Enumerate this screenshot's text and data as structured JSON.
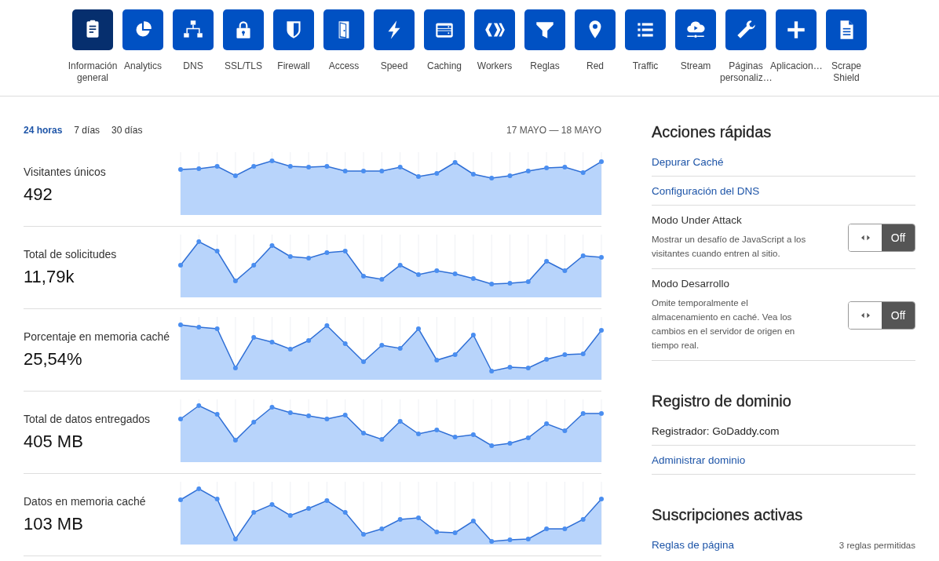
{
  "nav": [
    {
      "label": "Información general",
      "selected": true
    },
    {
      "label": "Analytics",
      "selected": false
    },
    {
      "label": "DNS",
      "selected": false
    },
    {
      "label": "SSL/TLS",
      "selected": false
    },
    {
      "label": "Firewall",
      "selected": false
    },
    {
      "label": "Access",
      "selected": false
    },
    {
      "label": "Speed",
      "selected": false
    },
    {
      "label": "Caching",
      "selected": false
    },
    {
      "label": "Workers",
      "selected": false
    },
    {
      "label": "Reglas",
      "selected": false
    },
    {
      "label": "Red",
      "selected": false
    },
    {
      "label": "Traffic",
      "selected": false
    },
    {
      "label": "Stream",
      "selected": false
    },
    {
      "label": "Páginas personaliz…",
      "selected": false
    },
    {
      "label": "Aplicacion…",
      "selected": false
    },
    {
      "label": "Scrape Shield",
      "selected": false
    }
  ],
  "range_tabs": [
    {
      "label": "24 horas",
      "selected": true
    },
    {
      "label": "7 días",
      "selected": false
    },
    {
      "label": "30 días",
      "selected": false
    }
  ],
  "date_range": "17 MAYO — 18 MAYO",
  "metrics": [
    {
      "label": "Visitantes únicos",
      "value": "492"
    },
    {
      "label": "Total de solicitudes",
      "value": "11,79k"
    },
    {
      "label": "Porcentaje en memoria caché",
      "value": "25,54%"
    },
    {
      "label": "Total de datos entregados",
      "value": "405 MB"
    },
    {
      "label": "Datos en memoria caché",
      "value": "103 MB"
    }
  ],
  "sidebar_sections": [
    {
      "title": "Acciones rápidas",
      "items": [
        {
          "kind": "link",
          "label": "Depurar Caché"
        },
        {
          "kind": "link",
          "label": "Configuración del DNS"
        },
        {
          "kind": "toggle",
          "label": "Modo Under Attack",
          "description": "Mostrar un desafío de JavaScript a los visitantes cuando entren al sitio.",
          "on": false,
          "state_label": "Off"
        },
        {
          "kind": "toggle",
          "label": "Modo Desarrollo",
          "description": "Omite temporalmente el almacenamiento en caché. Vea los cambios en el servidor de origen en tiempo real.",
          "on": false,
          "state_label": "Off"
        }
      ]
    },
    {
      "title": "Registro de dominio",
      "items": [
        {
          "kind": "text",
          "label": "Registrador: GoDaddy.com"
        },
        {
          "kind": "link",
          "label": "Administrar dominio"
        }
      ]
    },
    {
      "title": "Suscripciones activas",
      "items": [
        {
          "kind": "link_note",
          "label": "Reglas de página",
          "note": "3 reglas permitidas"
        }
      ]
    }
  ]
}
